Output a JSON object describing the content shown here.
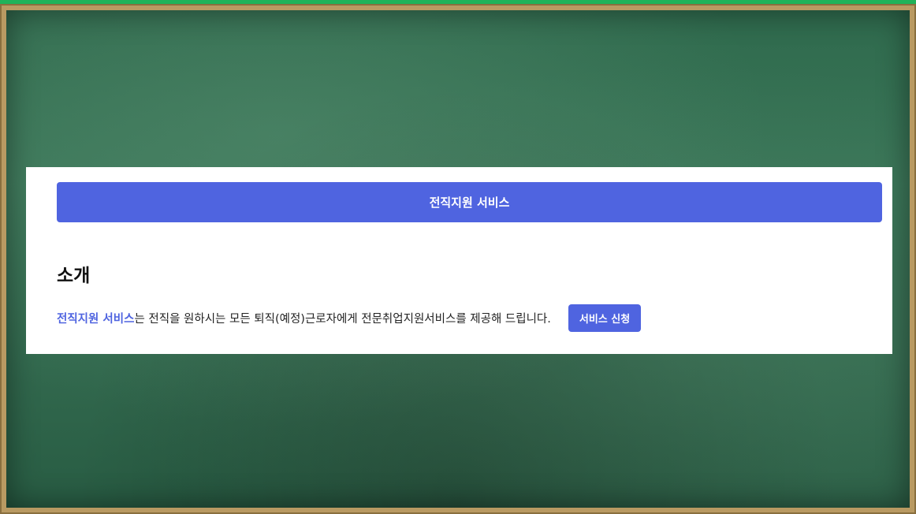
{
  "card": {
    "title": "전직지원 서비스",
    "section_heading": "소개",
    "intro": {
      "highlight": "전직지원 서비스",
      "text": "는 전직을 원하시는 모든 퇴직(예정)근로자에게 전문취업지원서비스를 제공해 드립니다."
    },
    "apply_button_label": "서비스 신청"
  },
  "colors": {
    "accent": "#4f64e0",
    "board": "#2f6a4d",
    "frame": "#b99a62",
    "border_green": "#1fb35a"
  }
}
